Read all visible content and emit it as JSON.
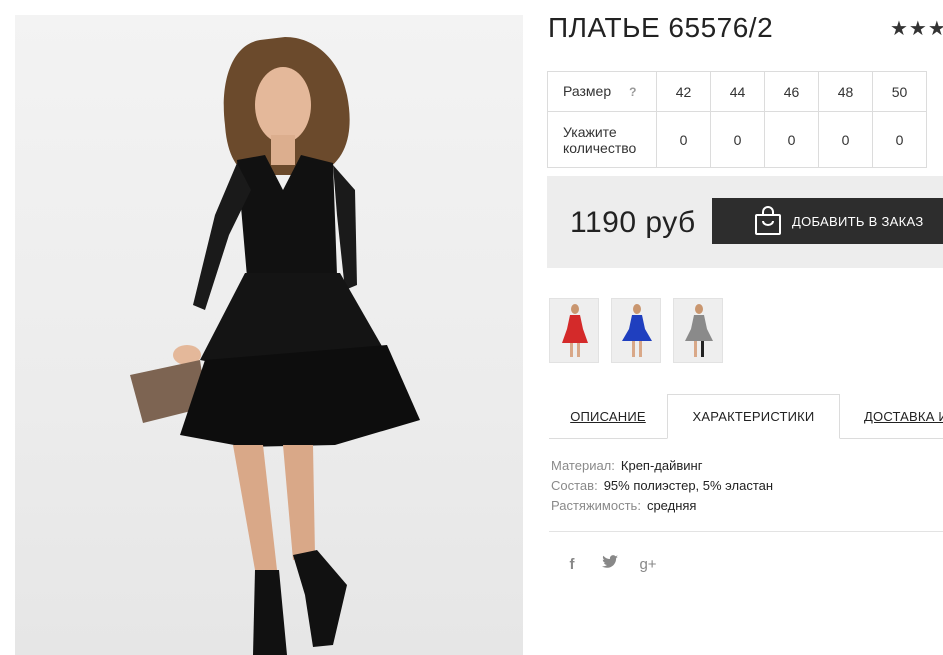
{
  "product": {
    "title": "ПЛАТЬЕ 65576/2",
    "rating_stars": "★★★"
  },
  "sizes": {
    "size_label": "Размер",
    "help": "?",
    "qty_label": "Укажите количество",
    "values": [
      "42",
      "44",
      "46",
      "48",
      "50"
    ],
    "quantities": [
      "0",
      "0",
      "0",
      "0",
      "0"
    ]
  },
  "price": {
    "amount": "1190 руб",
    "order_button": "ДОБАВИТЬ В ЗАКАЗ"
  },
  "thumbnails": [
    {
      "color_name": "red",
      "color": "#d42a2a"
    },
    {
      "color_name": "blue",
      "color": "#1f3fbf"
    },
    {
      "color_name": "grey",
      "color": "#8a8a8a"
    }
  ],
  "tabs": {
    "description": "ОПИСАНИЕ",
    "characteristics": "ХАРАКТЕРИСТИКИ",
    "delivery": "ДОСТАВКА И"
  },
  "characteristics": [
    {
      "key": "Материал:",
      "value": "Креп-дайвинг"
    },
    {
      "key": "Состав:",
      "value": "95% полиэстер, 5% эластан"
    },
    {
      "key": "Растяжимость:",
      "value": "средняя"
    }
  ],
  "social": {
    "facebook": "f",
    "twitter": "t",
    "google": "g+"
  },
  "colors": {
    "button_bg": "#2d2d2d",
    "price_box_bg": "#ededed",
    "border": "#dcdcdc"
  }
}
